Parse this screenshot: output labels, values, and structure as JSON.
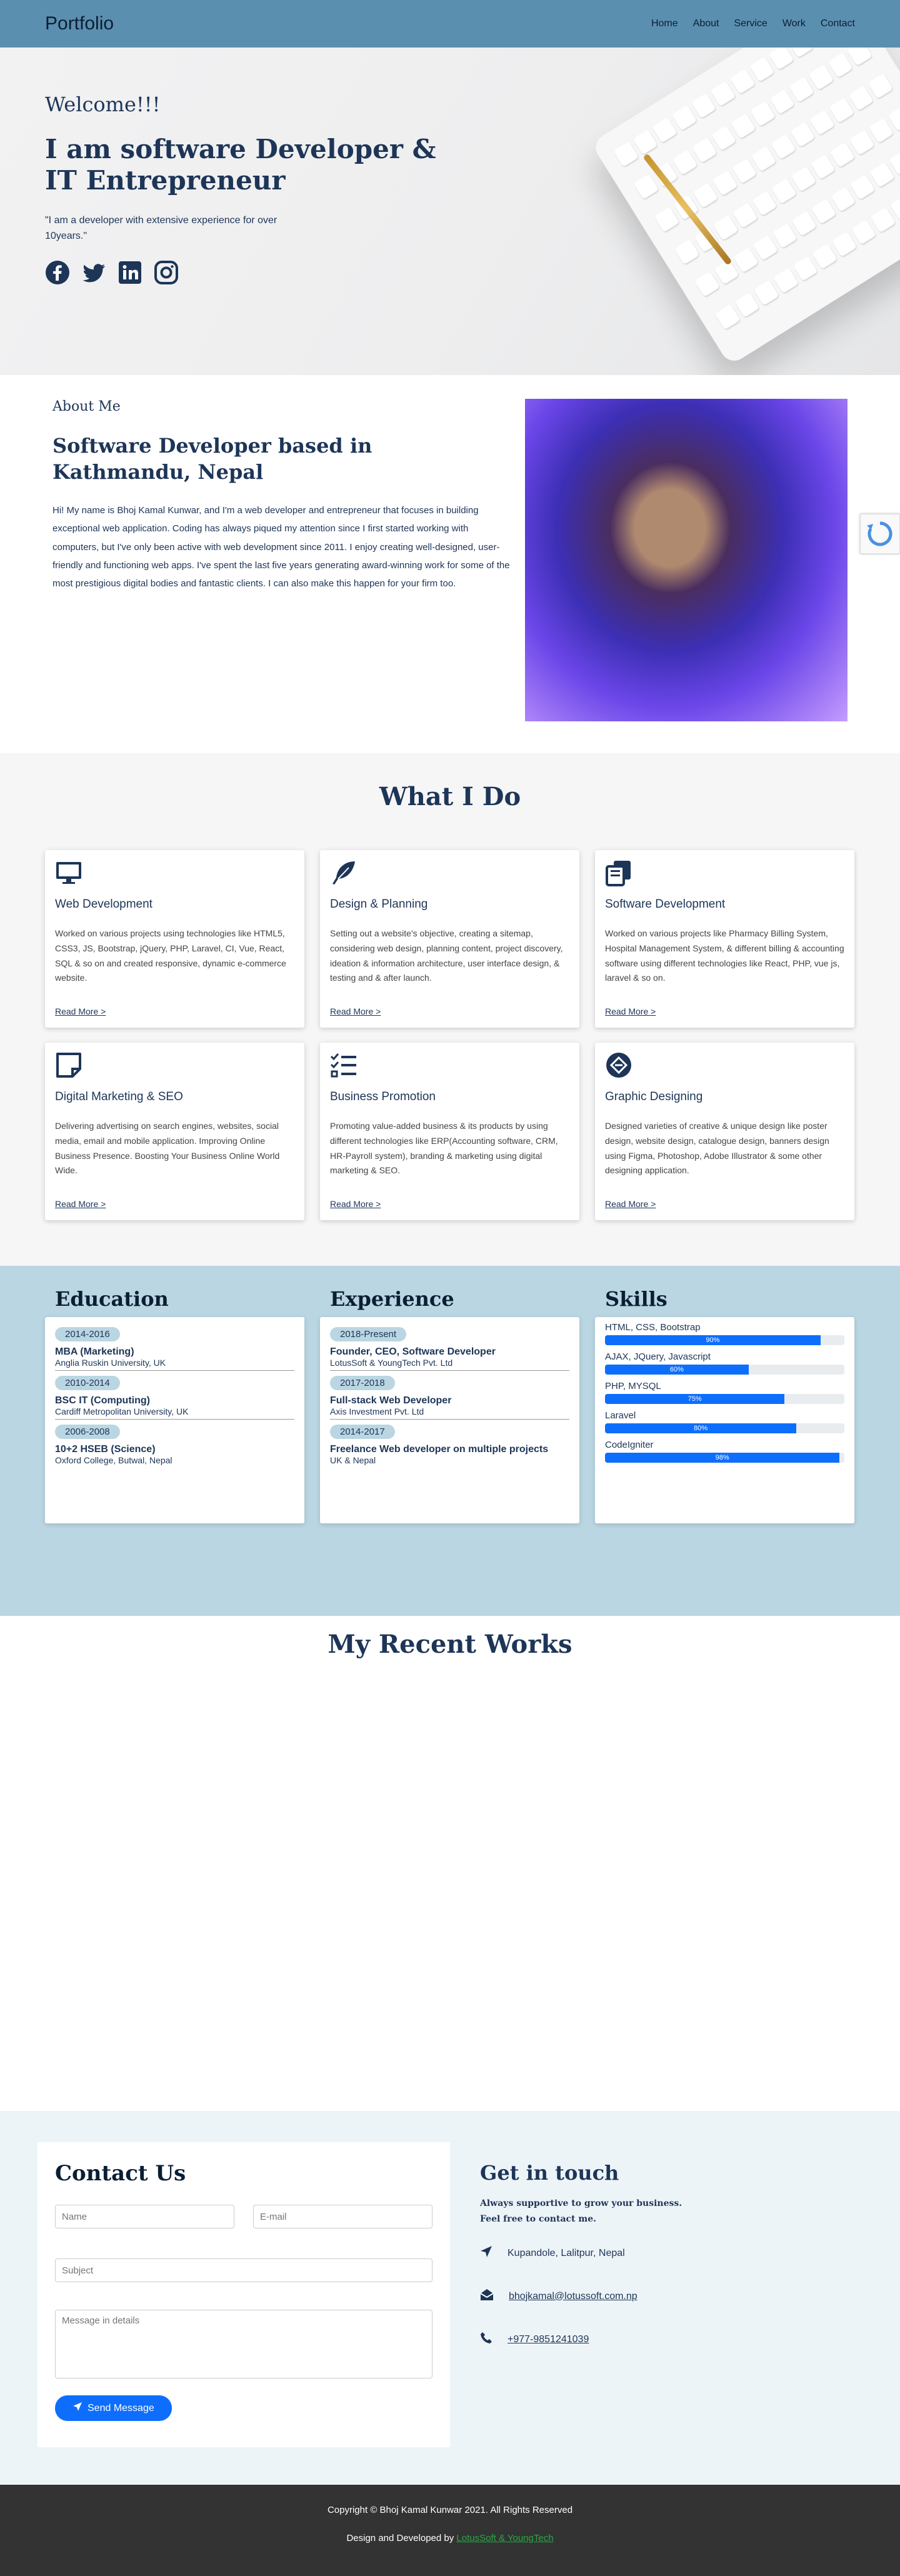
{
  "nav": {
    "brand": "Portfolio",
    "links": [
      "Home",
      "About",
      "Service",
      "Work",
      "Contact"
    ]
  },
  "hero": {
    "welcome": "Welcome!!!",
    "title": "I am software Developer & IT Entrepreneur",
    "quote": "\"I am a developer with extensive experience for over 10years.\"",
    "socials": [
      "facebook-icon",
      "twitter-icon",
      "linkedin-icon",
      "instagram-icon"
    ]
  },
  "about": {
    "eyebrow": "About Me",
    "title": "Software Developer based in Kathmandu, Nepal",
    "body": "Hi! My name is Bhoj Kamal Kunwar, and I'm a web developer and entrepreneur that focuses in building exceptional web application. Coding has always piqued my attention since I first started working with computers, but I've only been active with web development since 2011. I enjoy creating well-designed, user-friendly and functioning web apps. I've spent the last five years generating award-winning work for some of the most prestigious digital bodies and fantastic clients. I can also make this happen for your firm too."
  },
  "services": {
    "title": "What I Do",
    "read_more": "Read More >",
    "items": [
      {
        "icon": "monitor-icon",
        "title": "Web Development",
        "desc": "Worked on various projects using technologies like HTML5, CSS3, JS, Bootstrap, jQuery, PHP, Laravel, CI, Vue, React, SQL & so on and created responsive, dynamic e-commerce website."
      },
      {
        "icon": "feather-icon",
        "title": "Design & Planning",
        "desc": "Setting out a website's objective, creating a sitemap, considering web design, planning content, project discovery, ideation & information architecture, user interface design, & testing and & after launch."
      },
      {
        "icon": "copy-icon",
        "title": "Software Development",
        "desc": "Worked on various projects like Pharmacy Billing System, Hospital Management System, & different billing & accounting software using different technologies like React, PHP, vue js, laravel & so on."
      },
      {
        "icon": "sticky-note-icon",
        "title": "Digital Marketing & SEO",
        "desc": "Delivering advertising on search engines, websites, social media, email and mobile application. Improving Online Business Presence. Boosting Your Business Online World Wide."
      },
      {
        "icon": "checklist-icon",
        "title": "Business Promotion",
        "desc": "Promoting value-added business & its products by using different technologies like ERP(Accounting software, CRM, HR-Payroll system), branding & marketing using digital marketing & SEO."
      },
      {
        "icon": "diamond-icon",
        "title": "Graphic Designing",
        "desc": "Designed varieties of creative & unique design like poster design, website design, catalogue design, banners design using Figma, Photoshop, Adobe Illustrator & some other designing application."
      }
    ]
  },
  "education": {
    "title": "Education",
    "items": [
      {
        "years": "2014-2016",
        "title": "MBA (Marketing)",
        "org": "Anglia Ruskin University, UK"
      },
      {
        "years": "2010-2014",
        "title": "BSC IT (Computing)",
        "org": "Cardiff Metropolitan University, UK"
      },
      {
        "years": "2006-2008",
        "title": "10+2 HSEB (Science)",
        "org": "Oxford College, Butwal, Nepal"
      }
    ]
  },
  "experience": {
    "title": "Experience",
    "items": [
      {
        "years": "2018-Present",
        "title": "Founder, CEO, Software Developer",
        "org": "LotusSoft & YoungTech Pvt. Ltd"
      },
      {
        "years": "2017-2018",
        "title": "Full-stack Web Developer",
        "org": "Axis Investment Pvt. Ltd"
      },
      {
        "years": "2014-2017",
        "title": "Freelance Web developer on multiple projects",
        "org": "UK & Nepal"
      }
    ]
  },
  "skills": {
    "title": "Skills",
    "items": [
      {
        "label": "HTML, CSS, Bootstrap",
        "percent": 90,
        "text": "90%"
      },
      {
        "label": "AJAX, JQuery, Javascript",
        "percent": 60,
        "text": "60%"
      },
      {
        "label": "PHP, MYSQL",
        "percent": 75,
        "text": "75%"
      },
      {
        "label": "Laravel",
        "percent": 80,
        "text": "80%"
      },
      {
        "label": "CodeIgniter",
        "percent": 98,
        "text": "98%"
      }
    ]
  },
  "works": {
    "title": "My Recent Works"
  },
  "contact": {
    "title": "Contact Us",
    "name_placeholder": "Name",
    "email_placeholder": "E-mail",
    "subject_placeholder": "Subject",
    "message_placeholder": "Message in details",
    "send_label": "Send Message",
    "touch_title": "Get in touch",
    "touch_sub_1": "Always supportive to grow your business.",
    "touch_sub_2": "Feel free to contact me.",
    "address": "Kupandole, Lalitpur, Nepal",
    "email": "bhojkamal@lotussoft.com.np",
    "phone": "+977-9851241039"
  },
  "footer": {
    "copyright": "Copyright © Bhoj Kamal Kunwar 2021. All Rights Reserved",
    "dev_prefix": "Design and Developed by ",
    "dev_link": "LotusSoft & YoungTech"
  },
  "colors": {
    "nav_bg": "#5b8fb0",
    "primary_text": "#1d3557",
    "accent_blue": "#0d6efd",
    "resume_bg": "#bad6e2",
    "footer_bg": "#333333",
    "footer_link": "#28a745"
  }
}
